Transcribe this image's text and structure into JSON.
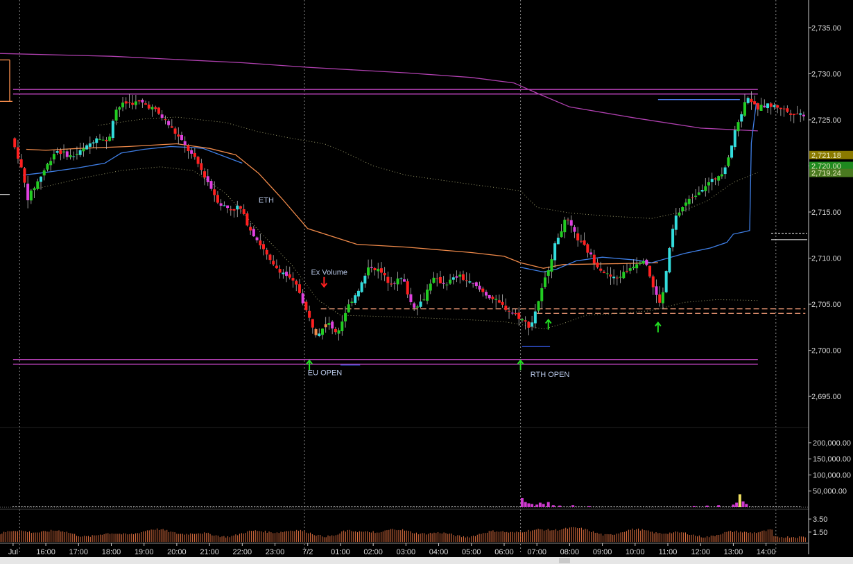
{
  "chart_data": {
    "type": "candlestick",
    "price_axis": {
      "ylim": [
        2692,
        2738
      ],
      "ticks": [
        "2,735.00",
        "2,730.00",
        "2,725.00",
        "2,720.00",
        "2,715.00",
        "2,710.00",
        "2,705.00",
        "2,700.00",
        "2,695.00"
      ],
      "tick_values": [
        2735,
        2730,
        2725,
        2720,
        2715,
        2710,
        2705,
        2700,
        2695
      ],
      "price_tags": [
        {
          "label": "2,721.18",
          "value": 2721.18,
          "color": "#8a7a00"
        },
        {
          "label": "2,720.00",
          "value": 2720.0,
          "color": "#1f8a1f"
        },
        {
          "label": "2,719.24",
          "value": 2719.24,
          "color": "#4a7a20"
        }
      ]
    },
    "volume_axis": {
      "ylim": [
        0,
        230000
      ],
      "ticks": [
        "200,000.00",
        "150,000.00",
        "100,000.00",
        "50,000.00"
      ],
      "tick_values": [
        200000,
        150000,
        100000,
        50000
      ]
    },
    "indicator_axis": {
      "ylim": [
        0,
        5
      ],
      "ticks": [
        "3.50",
        "1.50"
      ],
      "tick_values": [
        3.5,
        1.5
      ]
    },
    "time_axis": {
      "labels": [
        "Jul",
        "16:00",
        "17:00",
        "18:00",
        "19:00",
        "20:00",
        "21:00",
        "22:00",
        "23:00",
        "7/2",
        "01:00",
        "02:00",
        "03:00",
        "04:00",
        "05:00",
        "06:00",
        "07:00",
        "08:00",
        "09:00",
        "10:00",
        "11:00",
        "12:00",
        "13:00",
        "14:00"
      ],
      "hours": [
        15.0,
        16,
        17,
        18,
        19,
        20,
        21,
        22,
        23,
        24,
        25,
        26,
        27,
        28,
        29,
        30,
        31,
        32,
        33,
        34,
        35,
        36,
        37,
        38
      ],
      "session_lines_hours": [
        15.2,
        23.9,
        30.5,
        38.3
      ],
      "x_range_hours": [
        14.6,
        39.3
      ]
    },
    "annotations": [
      {
        "text": "ETH",
        "x": 22.5,
        "y": 2716.0
      },
      {
        "text": "Ex Volume",
        "x": 24.1,
        "y": 2708.2
      },
      {
        "text": "EU OPEN",
        "x": 24.0,
        "y": 2697.3
      },
      {
        "text": "RTH OPEN",
        "x": 30.8,
        "y": 2697.1
      }
    ],
    "arrows": [
      {
        "dir": "down",
        "x": 24.5,
        "y": 2706.9,
        "color": "#ff2020"
      },
      {
        "dir": "up",
        "x": 24.05,
        "y": 2698.9,
        "color": "#22dd22"
      },
      {
        "dir": "up",
        "x": 30.5,
        "y": 2698.9,
        "color": "#22dd22"
      },
      {
        "dir": "up",
        "x": 31.35,
        "y": 2703.3,
        "color": "#22dd22"
      },
      {
        "dir": "up",
        "x": 34.7,
        "y": 2703.0,
        "color": "#22dd22"
      }
    ],
    "levels": [
      {
        "value": 2728.3,
        "x1": 15.0,
        "x2": 37.75,
        "color": "#d24ad2"
      },
      {
        "value": 2727.8,
        "x1": 15.0,
        "x2": 37.75,
        "color": "#d24ad2"
      },
      {
        "value": 2699.0,
        "x1": 15.0,
        "x2": 37.75,
        "color": "#d24ad2"
      },
      {
        "value": 2698.5,
        "x1": 15.0,
        "x2": 37.75,
        "color": "#d24ad2"
      },
      {
        "value": 2704.5,
        "x1": 24.4,
        "x2": 39.2,
        "color": "#d88a6a",
        "dash": true
      },
      {
        "value": 2704.0,
        "x1": 31.0,
        "x2": 39.2,
        "color": "#d88a6a",
        "dash": true
      },
      {
        "value": 2727.2,
        "x1": 34.7,
        "x2": 37.2,
        "color": "#4f7df0"
      },
      {
        "value": 2700.4,
        "x1": 30.55,
        "x2": 31.4,
        "color": "#3050d0"
      },
      {
        "value": 2698.4,
        "x1": 25.0,
        "x2": 25.6,
        "color": "#3050d0"
      }
    ],
    "lines": [
      {
        "name": "upper",
        "color": "#b040b0",
        "points": [
          [
            14.6,
            2732.2
          ],
          [
            18,
            2731.9
          ],
          [
            22,
            2731.2
          ],
          [
            24,
            2730.7
          ],
          [
            27,
            2730.1
          ],
          [
            29,
            2729.6
          ],
          [
            30.3,
            2729.0
          ],
          [
            31,
            2727.9
          ],
          [
            32,
            2726.4
          ],
          [
            34,
            2725.2
          ],
          [
            36,
            2724.1
          ],
          [
            37.75,
            2723.8
          ]
        ]
      },
      {
        "name": "orange",
        "color": "#f08a4a",
        "points": [
          [
            15.4,
            2721.8
          ],
          [
            16,
            2721.7
          ],
          [
            17,
            2721.9
          ],
          [
            18.5,
            2722.1
          ],
          [
            20,
            2722.4
          ],
          [
            21,
            2721.9
          ],
          [
            21.8,
            2721.2
          ],
          [
            22.5,
            2719.2
          ],
          [
            23.2,
            2716.5
          ],
          [
            24,
            2713.2
          ],
          [
            25.5,
            2711.5
          ],
          [
            27,
            2711.2
          ],
          [
            29,
            2710.6
          ],
          [
            30,
            2710.2
          ],
          [
            30.5,
            2709.5
          ],
          [
            31.2,
            2708.9
          ],
          [
            31.8,
            2709.3
          ],
          [
            33.5,
            2709.4
          ],
          [
            34.7,
            2709.5
          ]
        ]
      },
      {
        "name": "vwap",
        "color": "#3f7fe6",
        "points": [
          [
            15.3,
            2719.0
          ],
          [
            16,
            2719.3
          ],
          [
            17,
            2719.8
          ],
          [
            17.8,
            2720.3
          ],
          [
            18.3,
            2721.4
          ],
          [
            19,
            2721.8
          ],
          [
            19.8,
            2722.1
          ],
          [
            20.5,
            2722.0
          ],
          [
            20.8,
            2721.9
          ],
          [
            22,
            2720.3
          ]
        ]
      },
      {
        "name": "vwap2",
        "color": "#3f7fe6",
        "points": [
          [
            30.5,
            2709.0
          ],
          [
            31.2,
            2708.5
          ],
          [
            31.6,
            2708.8
          ],
          [
            32.2,
            2709.7
          ],
          [
            33,
            2710.1
          ],
          [
            34,
            2709.8
          ],
          [
            34.5,
            2709.5
          ],
          [
            35.5,
            2710.5
          ],
          [
            36.3,
            2711.1
          ],
          [
            36.8,
            2711.7
          ],
          [
            37,
            2712.6
          ],
          [
            37.4,
            2712.9
          ],
          [
            37.5,
            2713.0
          ],
          [
            37.55,
            2722.5
          ],
          [
            37.7,
            2726.8
          ]
        ]
      }
    ],
    "dotted_bands": [
      {
        "color": "#9a9a6a",
        "points": [
          [
            15.8,
            2717.6
          ],
          [
            17,
            2718.6
          ],
          [
            18.3,
            2719.5
          ],
          [
            19.5,
            2719.9
          ],
          [
            20.5,
            2719.5
          ],
          [
            21.5,
            2717.0
          ],
          [
            22.5,
            2713.0
          ],
          [
            23.5,
            2709.3
          ],
          [
            24.3,
            2705.5
          ],
          [
            25,
            2703.8
          ],
          [
            27,
            2703.6
          ],
          [
            29,
            2703.3
          ],
          [
            30,
            2703.1
          ],
          [
            30.5,
            2702.8
          ],
          [
            31.2,
            2702.3
          ],
          [
            31.8,
            2702.9
          ],
          [
            32.5,
            2703.8
          ],
          [
            33.5,
            2704.0
          ],
          [
            34.5,
            2704.3
          ],
          [
            35.5,
            2705.2
          ],
          [
            36.5,
            2705.5
          ],
          [
            37.75,
            2705.4
          ]
        ]
      },
      {
        "color": "#9a9a6a",
        "points": [
          [
            17.6,
            2724.4
          ],
          [
            19,
            2725.1
          ],
          [
            20,
            2725.3
          ],
          [
            21.5,
            2724.7
          ],
          [
            22.5,
            2723.7
          ],
          [
            23.5,
            2723.0
          ],
          [
            24.5,
            2722.4
          ],
          [
            25,
            2721.7
          ],
          [
            26,
            2720.0
          ],
          [
            27,
            2719.0
          ],
          [
            29,
            2718.0
          ],
          [
            30.5,
            2717.3
          ],
          [
            31,
            2715.5
          ],
          [
            32,
            2714.9
          ],
          [
            33,
            2714.6
          ],
          [
            34.5,
            2714.3
          ],
          [
            35.3,
            2714.9
          ],
          [
            36.2,
            2716.2
          ],
          [
            37,
            2718.2
          ],
          [
            37.75,
            2719.3
          ]
        ]
      }
    ],
    "price_path": [
      [
        15.05,
        2723.0
      ],
      [
        15.3,
        2720.5
      ],
      [
        15.55,
        2716.5
      ],
      [
        15.9,
        2718.6
      ],
      [
        16.4,
        2721.7
      ],
      [
        16.9,
        2721.0
      ],
      [
        17.3,
        2721.9
      ],
      [
        17.7,
        2723.3
      ],
      [
        18.0,
        2722.4
      ],
      [
        18.2,
        2726.0
      ],
      [
        18.5,
        2726.8
      ],
      [
        19.0,
        2726.9
      ],
      [
        19.4,
        2726.2
      ],
      [
        19.8,
        2724.7
      ],
      [
        20.2,
        2722.9
      ],
      [
        20.7,
        2720.5
      ],
      [
        21.0,
        2718.6
      ],
      [
        21.4,
        2715.9
      ],
      [
        21.8,
        2715.2
      ],
      [
        22.0,
        2715.7
      ],
      [
        22.3,
        2713.4
      ],
      [
        22.7,
        2711.2
      ],
      [
        23.0,
        2709.3
      ],
      [
        23.4,
        2708.3
      ],
      [
        23.8,
        2706.8
      ],
      [
        24.1,
        2703.8
      ],
      [
        24.4,
        2701.5
      ],
      [
        24.7,
        2703.2
      ],
      [
        25.0,
        2701.8
      ],
      [
        25.3,
        2704.6
      ],
      [
        25.7,
        2706.9
      ],
      [
        26.0,
        2709.2
      ],
      [
        26.3,
        2708.6
      ],
      [
        26.6,
        2707.3
      ],
      [
        27.0,
        2707.8
      ],
      [
        27.3,
        2704.7
      ],
      [
        27.6,
        2705.3
      ],
      [
        27.9,
        2707.8
      ],
      [
        28.3,
        2707.2
      ],
      [
        28.7,
        2708.1
      ],
      [
        29.1,
        2707.2
      ],
      [
        29.5,
        2706.2
      ],
      [
        29.9,
        2705.2
      ],
      [
        30.3,
        2704.2
      ],
      [
        30.6,
        2703.5
      ],
      [
        30.9,
        2702.5
      ],
      [
        31.2,
        2706.0
      ],
      [
        31.5,
        2709.5
      ],
      [
        31.7,
        2712.0
      ],
      [
        32.0,
        2714.3
      ],
      [
        32.3,
        2712.3
      ],
      [
        32.6,
        2711.0
      ],
      [
        32.9,
        2709.4
      ],
      [
        33.2,
        2708.3
      ],
      [
        33.5,
        2707.7
      ],
      [
        33.8,
        2708.5
      ],
      [
        34.1,
        2709.4
      ],
      [
        34.4,
        2710.0
      ],
      [
        34.7,
        2706.2
      ],
      [
        34.9,
        2705.0
      ],
      [
        35.1,
        2709.8
      ],
      [
        35.3,
        2714.2
      ],
      [
        35.6,
        2715.8
      ],
      [
        35.9,
        2716.8
      ],
      [
        36.2,
        2717.8
      ],
      [
        36.5,
        2718.5
      ],
      [
        36.8,
        2719.5
      ],
      [
        37.0,
        2721.6
      ],
      [
        37.2,
        2724.3
      ],
      [
        37.4,
        2726.3
      ],
      [
        37.55,
        2727.6
      ],
      [
        37.8,
        2726.2
      ],
      [
        38.1,
        2726.6
      ],
      [
        38.5,
        2726.4
      ],
      [
        38.8,
        2725.8
      ],
      [
        39.2,
        2725.6
      ]
    ],
    "volume_spikes": [
      {
        "x": 30.55,
        "value": 28000
      },
      {
        "x": 30.65,
        "value": 16000
      },
      {
        "x": 30.75,
        "value": 12000
      },
      {
        "x": 30.85,
        "value": 10000
      },
      {
        "x": 31.0,
        "value": 8000
      },
      {
        "x": 31.1,
        "value": 14000
      },
      {
        "x": 31.2,
        "value": 10000
      },
      {
        "x": 31.35,
        "value": 16000
      },
      {
        "x": 31.5,
        "value": 6000
      },
      {
        "x": 31.7,
        "value": 5000
      },
      {
        "x": 32.1,
        "value": 6000
      },
      {
        "x": 32.6,
        "value": 3500
      },
      {
        "x": 35.8,
        "value": 4000
      },
      {
        "x": 36.2,
        "value": 5000
      },
      {
        "x": 36.55,
        "value": 6000
      },
      {
        "x": 37.0,
        "value": 8000
      },
      {
        "x": 37.1,
        "value": 14000
      },
      {
        "x": 37.2,
        "value": 40000
      },
      {
        "x": 37.3,
        "value": 18000
      },
      {
        "x": 37.4,
        "value": 10000
      }
    ]
  }
}
